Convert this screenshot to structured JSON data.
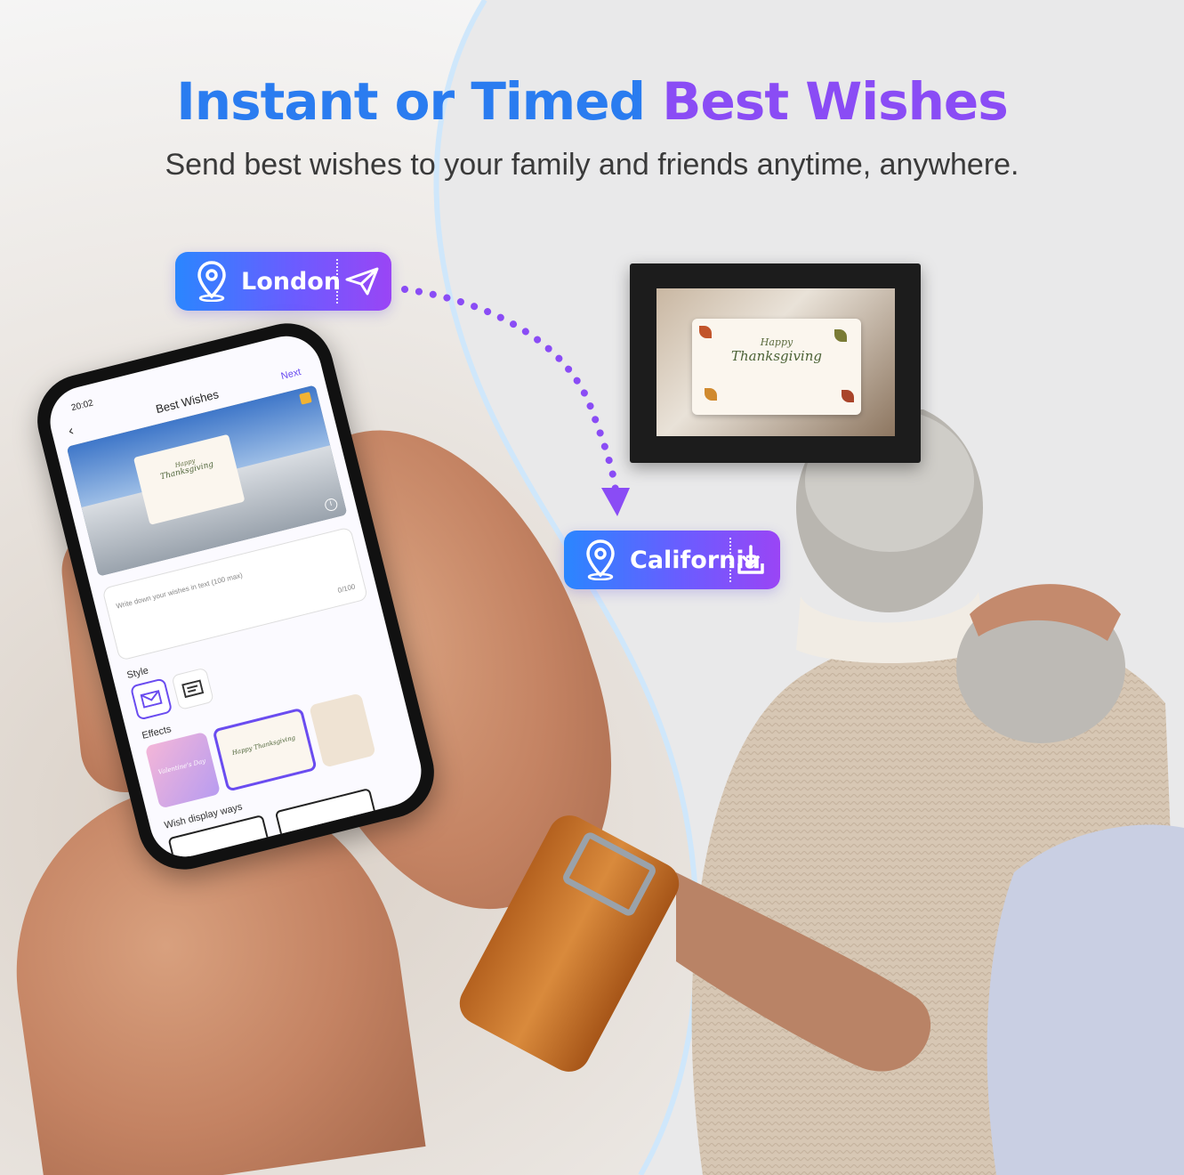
{
  "headline": {
    "part1": "Instant or Timed",
    "part2": "Best Wishes"
  },
  "subheadline": "Send best wishes to your family and friends anytime, anywhere.",
  "colors": {
    "headline_blue": "#2a7cf0",
    "headline_purple": "#8a4cf5",
    "arrow": "#8a4cf5",
    "pill_gradient_start": "#2a86ff",
    "pill_gradient_end": "#9a45f5"
  },
  "origin_pill": {
    "label": "London",
    "left_icon": "location-pin-icon",
    "right_icon": "paper-plane-icon"
  },
  "destination_pill": {
    "label": "California",
    "left_icon": "location-pin-icon",
    "right_icon": "download-icon"
  },
  "frame_card": {
    "line1": "Happy",
    "line2": "Thanksgiving"
  },
  "phone": {
    "status_time": "20:02",
    "title": "Best Wishes",
    "next": "Next",
    "back_icon": "chevron-left-icon",
    "preview_card": {
      "line1": "Happy",
      "line2": "Thanksgiving"
    },
    "text_placeholder": "Write down your wishes in text  (100 max)",
    "text_counter": "0/100",
    "style_label": "Style",
    "effects_label": "Effects",
    "effects": [
      {
        "label": "Valentine's Day"
      },
      {
        "label": "Happy Thanksgiving"
      }
    ],
    "display_label": "Wish display ways"
  }
}
